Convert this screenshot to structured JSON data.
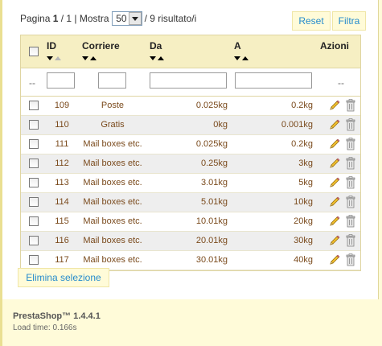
{
  "pager": {
    "page_label": "Pagina",
    "page_current": "1",
    "page_sep": "/ 1 | Mostra",
    "per_page": "50",
    "results": "/ 9 risultato/i"
  },
  "buttons": {
    "reset": "Reset",
    "filter": "Filtra",
    "delete_selection": "Elimina selezione"
  },
  "table": {
    "columns": {
      "id": "ID",
      "carrier": "Corriere",
      "from": "Da",
      "to": "A",
      "actions": "Azioni"
    },
    "filter_dash": "--",
    "rows": [
      {
        "id": "109",
        "carrier": "Poste",
        "from": "0.025kg",
        "to": "0.2kg"
      },
      {
        "id": "110",
        "carrier": "Gratis",
        "from": "0kg",
        "to": "0.001kg"
      },
      {
        "id": "111",
        "carrier": "Mail boxes etc.",
        "from": "0.025kg",
        "to": "0.2kg"
      },
      {
        "id": "112",
        "carrier": "Mail boxes etc.",
        "from": "0.25kg",
        "to": "3kg"
      },
      {
        "id": "113",
        "carrier": "Mail boxes etc.",
        "from": "3.01kg",
        "to": "5kg"
      },
      {
        "id": "114",
        "carrier": "Mail boxes etc.",
        "from": "5.01kg",
        "to": "10kg"
      },
      {
        "id": "115",
        "carrier": "Mail boxes etc.",
        "from": "10.01kg",
        "to": "20kg"
      },
      {
        "id": "116",
        "carrier": "Mail boxes etc.",
        "from": "20.01kg",
        "to": "30kg"
      },
      {
        "id": "117",
        "carrier": "Mail boxes etc.",
        "from": "30.01kg",
        "to": "40kg"
      }
    ]
  },
  "footer": {
    "version": "PrestaShop™ 1.4.4.1",
    "load_time": "Load time: 0.166s"
  },
  "icons": {
    "edit": "pencil-icon",
    "delete": "trash-icon",
    "sort_down": "sort-desc-icon",
    "sort_up": "sort-asc-icon"
  },
  "colors": {
    "background": "#fffbd9",
    "header": "#f6efc3",
    "link": "#268ccd",
    "cell_text": "#7a4a1c",
    "alt_row": "#eeeeee"
  }
}
